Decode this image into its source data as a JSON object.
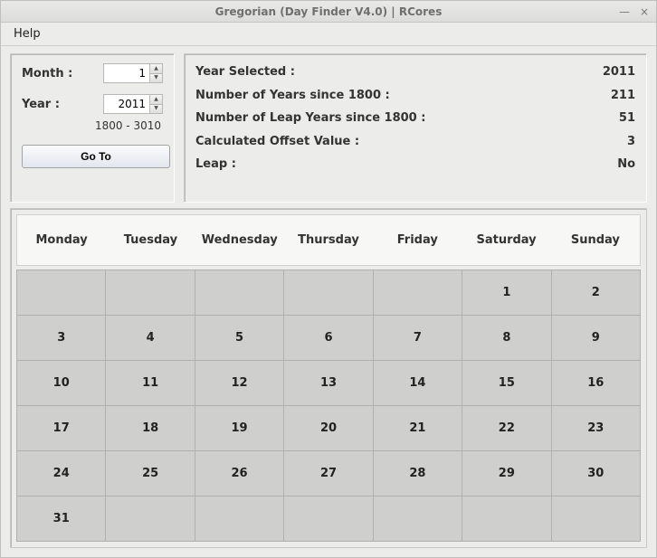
{
  "window": {
    "title": "Gregorian (Day Finder V4.0) | RCores"
  },
  "menu": {
    "help": "Help"
  },
  "form": {
    "month_label": "Month :",
    "month_value": "1",
    "year_label": "Year :",
    "year_value": "2011",
    "year_range": "1800 - 3010",
    "goto_label": "Go To"
  },
  "info": {
    "year_selected_label": "Year Selected :",
    "year_selected_value": "2011",
    "years_since_label": "Number of Years since 1800 :",
    "years_since_value": "211",
    "leap_years_label": "Number of Leap Years since 1800 :",
    "leap_years_value": "51",
    "offset_label": "Calculated Offset Value :",
    "offset_value": "3",
    "leap_label": "Leap :",
    "leap_value": "No"
  },
  "calendar": {
    "days": [
      "Monday",
      "Tuesday",
      "Wednesday",
      "Thursday",
      "Friday",
      "Saturday",
      "Sunday"
    ],
    "cells": [
      "",
      "",
      "",
      "",
      "",
      "1",
      "2",
      "3",
      "4",
      "5",
      "6",
      "7",
      "8",
      "9",
      "10",
      "11",
      "12",
      "13",
      "14",
      "15",
      "16",
      "17",
      "18",
      "19",
      "20",
      "21",
      "22",
      "23",
      "24",
      "25",
      "26",
      "27",
      "28",
      "29",
      "30",
      "31",
      "",
      "",
      "",
      "",
      "",
      ""
    ]
  }
}
